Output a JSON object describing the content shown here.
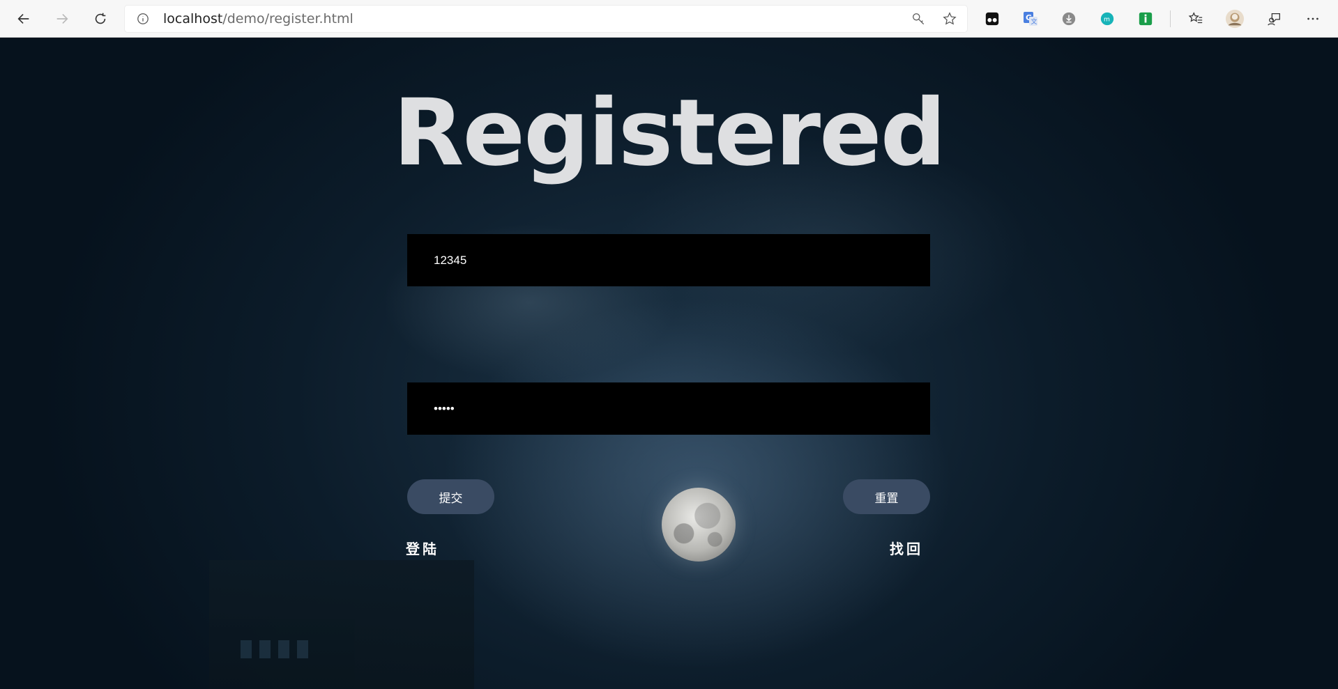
{
  "browser": {
    "url_host": "localhost",
    "url_path": "/demo/register.html",
    "nav_icons": [
      "back-icon",
      "forward-icon",
      "refresh-icon"
    ],
    "address_icons": [
      "info-icon",
      "key-icon",
      "star-icon"
    ],
    "extension_icons": [
      "tampermonkey-icon",
      "translate-icon",
      "download-icon",
      "extension-teal-icon",
      "extension-green-icon",
      "favorites-icon",
      "profile-avatar-icon",
      "feedback-icon",
      "more-icon"
    ]
  },
  "page": {
    "title": "Registered",
    "username_value": "12345",
    "password_value": "12345",
    "submit_label": "提交",
    "reset_label": "重置",
    "login_link": "登陆",
    "recover_link": "找回"
  },
  "colors": {
    "title": "#dedfe1",
    "field_bg": "#000000",
    "button_bg": "#3a4b63",
    "page_bg": "#0c1c2a"
  }
}
